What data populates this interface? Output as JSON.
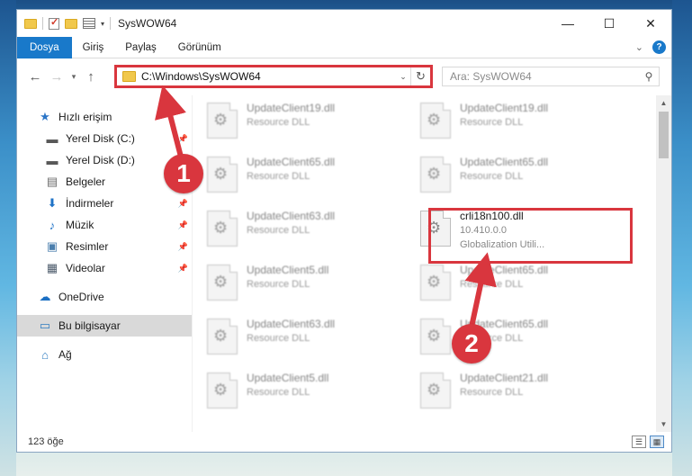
{
  "window": {
    "title": "SysWOW64",
    "controls": {
      "minimize": "—",
      "maximize": "☐",
      "close": "✕"
    }
  },
  "ribbon": {
    "tabs": [
      "Dosya",
      "Giriş",
      "Paylaş",
      "Görünüm"
    ],
    "help_label": "?"
  },
  "nav": {
    "address_path": "C:\\Windows\\SysWOW64",
    "search_placeholder": "Ara: SysWOW64"
  },
  "sidebar": {
    "items": [
      {
        "label": "Hızlı erişim",
        "icon": "star-icon"
      },
      {
        "label": "Yerel Disk (C:)",
        "icon": "drive-icon",
        "pinned": true
      },
      {
        "label": "Yerel Disk (D:)",
        "icon": "drive-icon",
        "pinned": true
      },
      {
        "label": "Belgeler",
        "icon": "documents-icon",
        "pinned": true
      },
      {
        "label": "İndirmeler",
        "icon": "download-icon",
        "pinned": true
      },
      {
        "label": "Müzik",
        "icon": "music-icon",
        "pinned": true
      },
      {
        "label": "Resimler",
        "icon": "pictures-icon",
        "pinned": true
      },
      {
        "label": "Videolar",
        "icon": "videos-icon",
        "pinned": true
      },
      {
        "label": "OneDrive",
        "icon": "onedrive-icon"
      },
      {
        "label": "Bu bilgisayar",
        "icon": "computer-icon",
        "selected": true
      },
      {
        "label": "Ağ",
        "icon": "network-icon"
      }
    ]
  },
  "files": [
    {
      "name": "UpdateClient19.dll",
      "sub": "Resource DLL"
    },
    {
      "name": "UpdateClient19.dll",
      "sub": "Resource DLL"
    },
    {
      "name": "UpdateClient65.dll",
      "sub": "Resource DLL"
    },
    {
      "name": "UpdateClient65.dll",
      "sub": "Resource DLL"
    },
    {
      "name": "UpdateClient63.dll",
      "sub": "Resource DLL"
    },
    {
      "name": "crli18n100.dll",
      "sub": "10.410.0.0",
      "sub2": "Globalization Utili...",
      "highlighted": true
    },
    {
      "name": "UpdateClient5.dll",
      "sub": "Resource DLL"
    },
    {
      "name": "UpdateClient65.dll",
      "sub": "Resource DLL"
    },
    {
      "name": "UpdateClient63.dll",
      "sub": "Resource DLL"
    },
    {
      "name": "UpdateClient65.dll",
      "sub": "Resource DLL"
    },
    {
      "name": "UpdateClient5.dll",
      "sub": "Resource DLL"
    },
    {
      "name": "UpdateClient21.dll",
      "sub": "Resource DLL"
    }
  ],
  "status": {
    "count": "123 öğe"
  },
  "callouts": {
    "one": "1",
    "two": "2"
  },
  "colors": {
    "accent": "#1979ca",
    "highlight": "#d9363e"
  }
}
